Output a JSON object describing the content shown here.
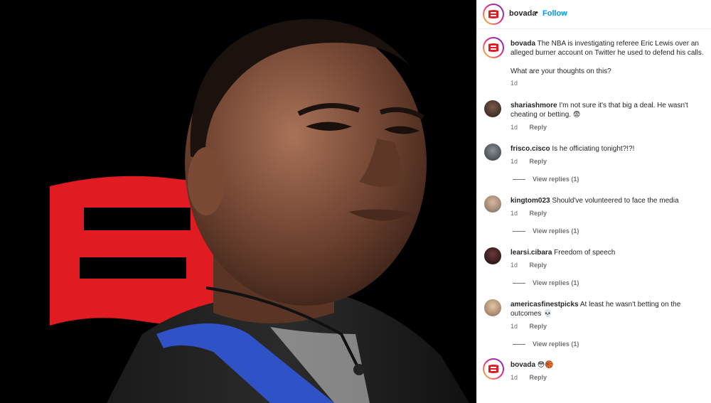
{
  "header": {
    "username": "bovada",
    "dot": "•",
    "follow_label": "Follow"
  },
  "caption": {
    "username": "bovada",
    "text": "The NBA is investigating referee Eric Lewis over an alleged burner account on Twitter he used to defend his calls.",
    "question": "What are your thoughts on this?",
    "time": "1d"
  },
  "comments": [
    {
      "username": "shariashmore",
      "text": "I'm not sure it's that big a deal. He wasn't cheating or betting. 😨",
      "time": "1d",
      "reply": "Reply",
      "view_replies": ""
    },
    {
      "username": "frisco.cisco",
      "text": "Is he officiating tonight?!?!",
      "time": "1d",
      "reply": "Reply",
      "view_replies": "View replies (1)"
    },
    {
      "username": "kingtom023",
      "text": "Should've volunteered to face the media",
      "time": "1d",
      "reply": "Reply",
      "view_replies": "View replies (1)"
    },
    {
      "username": "learsi.cibara",
      "text": "Freedom of speech",
      "time": "1d",
      "reply": "Reply",
      "view_replies": "View replies (1)"
    },
    {
      "username": "americasfinestpicks",
      "text": "At least he wasn't betting on the outcomes 💀",
      "time": "1d",
      "reply": "Reply",
      "view_replies": "View replies (1)"
    },
    {
      "username": "bovada",
      "text": "😳🏀",
      "time": "1d",
      "reply": "Reply",
      "view_replies": ""
    }
  ],
  "colors": {
    "brand_red": "#e11b22",
    "link_blue": "#0095f6",
    "meta_gray": "#737373"
  },
  "icons": {
    "brand_logo": "bovada-logo-icon"
  }
}
